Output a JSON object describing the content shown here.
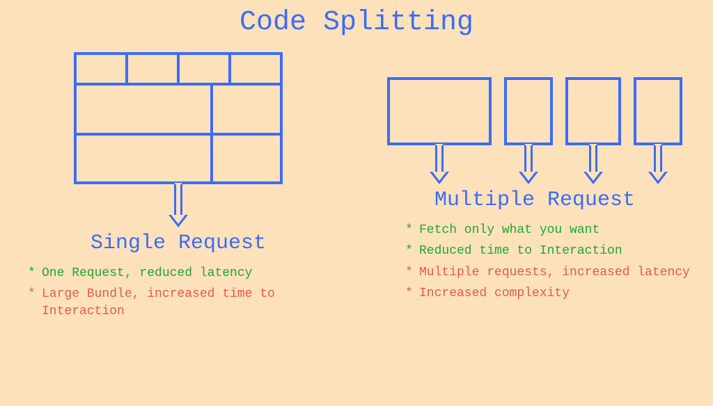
{
  "title": "Code Splitting",
  "left": {
    "subtitle": "Single Request",
    "bullets": [
      {
        "kind": "pro",
        "text": "One Request, reduced latency"
      },
      {
        "kind": "con",
        "text": "Large Bundle, increased time to Interaction"
      }
    ]
  },
  "right": {
    "subtitle": "Multiple Request",
    "bullets": [
      {
        "kind": "pro",
        "text": "Fetch only what you want"
      },
      {
        "kind": "pro",
        "text": "Reduced time to Interaction"
      },
      {
        "kind": "con",
        "text": "Multiple requests, increased latency"
      },
      {
        "kind": "con",
        "text": "Increased complexity"
      }
    ]
  }
}
